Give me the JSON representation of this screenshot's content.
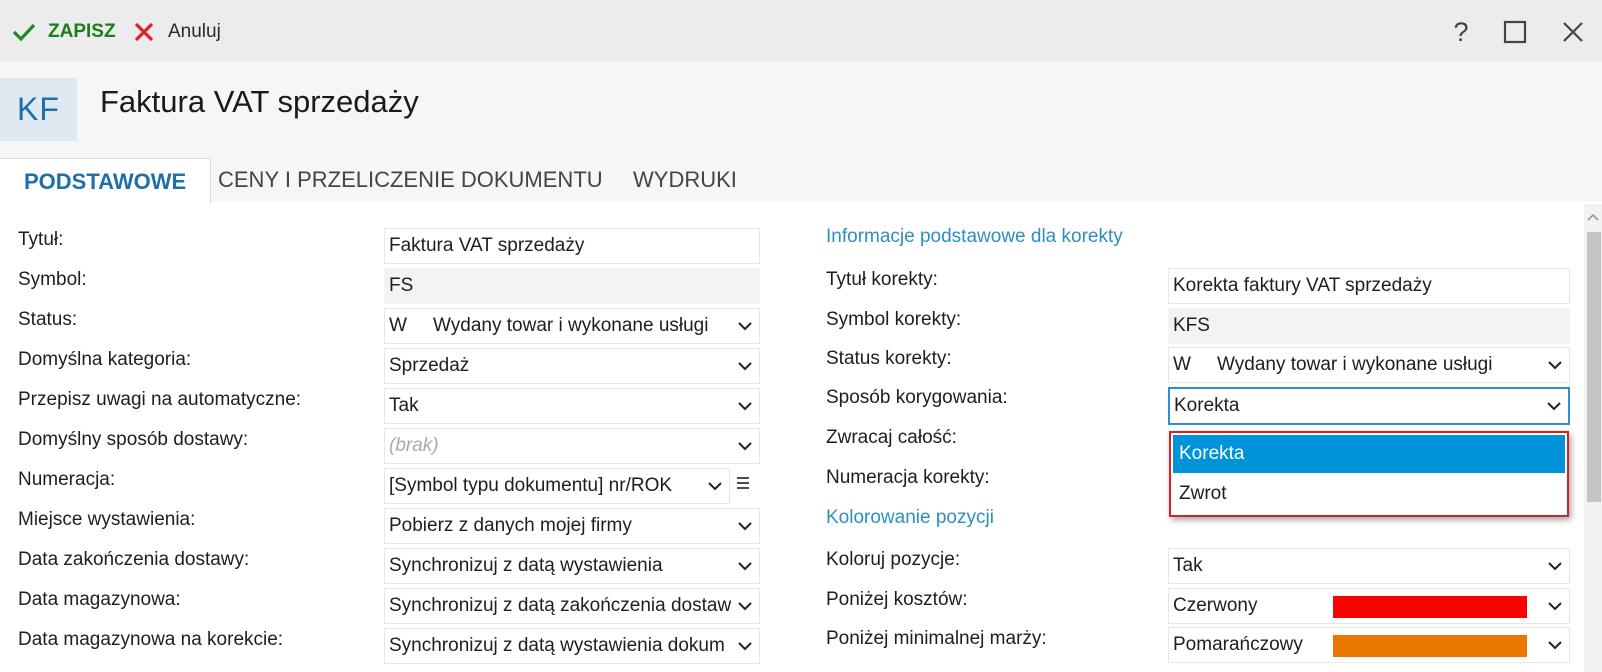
{
  "toolbar": {
    "save_label": "ZAPISZ",
    "cancel_label": "Anuluj",
    "help_label": "?"
  },
  "header": {
    "badge": "KF",
    "title": "Faktura VAT sprzedaży"
  },
  "tabs": [
    "PODSTAWOWE",
    "CENY I PRZELICZENIE DOKUMENTU",
    "WYDRUKI"
  ],
  "left": {
    "labels": [
      "Tytuł:",
      "Symbol:",
      "Status:",
      "Domyślna kategoria:",
      "Przepisz uwagi na automatyczne:",
      "Domyślny sposób dostawy:",
      "Numeracja:",
      "Miejsce wystawienia:",
      "Data zakończenia dostawy:",
      "Data magazynowa:",
      "Data magazynowa na korekcie:"
    ],
    "title_value": "Faktura VAT sprzedaży",
    "symbol_value": "FS",
    "status_code": "W",
    "status_value": "Wydany towar i wykonane usługi",
    "category_value": "Sprzedaż",
    "notes_value": "Tak",
    "delivery_placeholder": "(brak)",
    "numbering_value": "[Symbol typu dokumentu] nr/ROK",
    "place_value": "Pobierz z danych mojej firmy",
    "delivery_end_value": "Synchronizuj z datą wystawienia",
    "warehouse_date_value": "Synchronizuj z datą zakończenia dostaw",
    "warehouse_corr_value": "Synchronizuj z datą wystawienia dokum"
  },
  "right": {
    "section1": "Informacje podstawowe dla korekty",
    "labels": [
      "Tytuł korekty:",
      "Symbol korekty:",
      "Status korekty:",
      "Sposób korygowania:",
      "Zwracaj całość:",
      "Numeracja korekty:"
    ],
    "corr_title_value": "Korekta faktury VAT sprzedaży",
    "corr_symbol_value": "KFS",
    "corr_status_code": "W",
    "corr_status_value": "Wydany towar i wykonane usługi",
    "corr_method_value": "Korekta",
    "section2": "Kolorowanie pozycji",
    "labels2": [
      "Koloruj pozycje:",
      "Poniżej kosztów:",
      "Poniżej minimalnej marży:"
    ],
    "color_items_value": "Tak",
    "below_cost_value": "Czerwony",
    "below_cost_color": "#ff0000",
    "below_margin_value": "Pomarańczowy",
    "below_margin_color": "#e87800"
  },
  "dropdown": {
    "options": [
      "Korekta",
      "Zwrot"
    ],
    "selected": "Korekta"
  }
}
